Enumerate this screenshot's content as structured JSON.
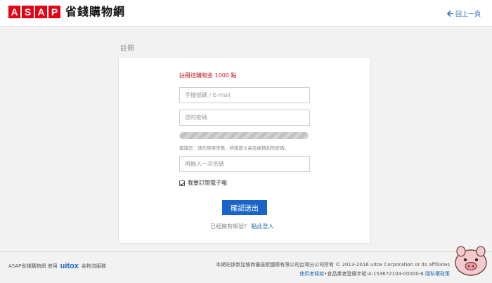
{
  "header": {
    "logo_letters": [
      "A",
      "S",
      "A",
      "P"
    ],
    "logo_text": "省錢購物網",
    "back_label": "回上一頁"
  },
  "page": {
    "title": "註冊"
  },
  "form": {
    "promo": "註冊送購物金 1000 點",
    "account_placeholder": "手機號碼 / E-mail",
    "password_placeholder": "您的密碼",
    "password_hint": "建議您：請勿使用常態、辨識度太高及被猜到的密碼。",
    "confirm_placeholder": "再輸入一次密碼",
    "newsletter_label": "我要訂閱電子報",
    "newsletter_checked": true,
    "submit_label": "確認送出",
    "login_prompt": "已經擁有帳號？",
    "login_link": "點此登入"
  },
  "footer": {
    "left_prefix": "ASAP省錢購物網 使用",
    "brand": "uitox",
    "left_suffix": "金物流服務",
    "copyright": "本網站係新加坡商優識斯國際有限公司台灣分公司所有 © 2013-2016 uitox Corporation or its affiliates",
    "terms_link": "使用者條款",
    "license_text": "•食品業者登錄字號:A-153672104-00000-6",
    "privacy_link": "隱私權政策"
  },
  "colors": {
    "brand_red": "#e60012",
    "link_blue": "#2a6db5",
    "button_blue": "#1a64c9",
    "promo_red": "#c8161d"
  },
  "icons": {
    "back": "arrow-left-icon",
    "mascot": "pig-mascot-icon"
  }
}
